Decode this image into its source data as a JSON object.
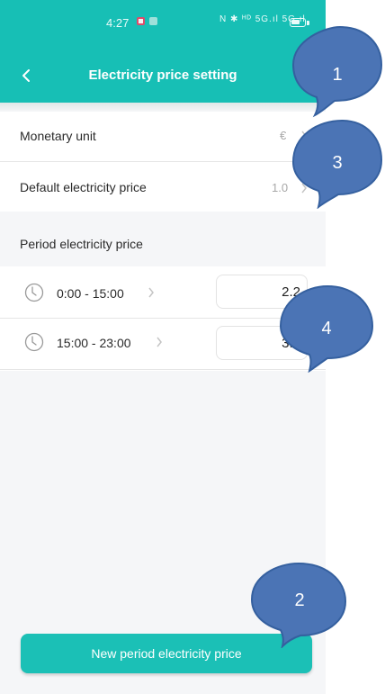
{
  "status_bar": {
    "time": "4:27",
    "right_icons": "N ✱ ᴴᴰ 5G.ıl 5G.ıl"
  },
  "header": {
    "title": "Electricity price setting"
  },
  "settings": {
    "monetary_unit_label": "Monetary unit",
    "monetary_unit_value": "€",
    "default_price_label": "Default electricity price",
    "default_price_value": "1.0"
  },
  "periods": {
    "section_label": "Period electricity price",
    "items": [
      {
        "time_range": "0:00 - 15:00",
        "price": "2.2"
      },
      {
        "time_range": "15:00 - 23:00",
        "price": "3.0"
      }
    ]
  },
  "footer": {
    "new_button_label": "New period electricity price"
  },
  "annotations": [
    "1",
    "3",
    "4",
    "2"
  ],
  "colors": {
    "accent": "#17bfb5",
    "callout": "#4b74b5"
  }
}
